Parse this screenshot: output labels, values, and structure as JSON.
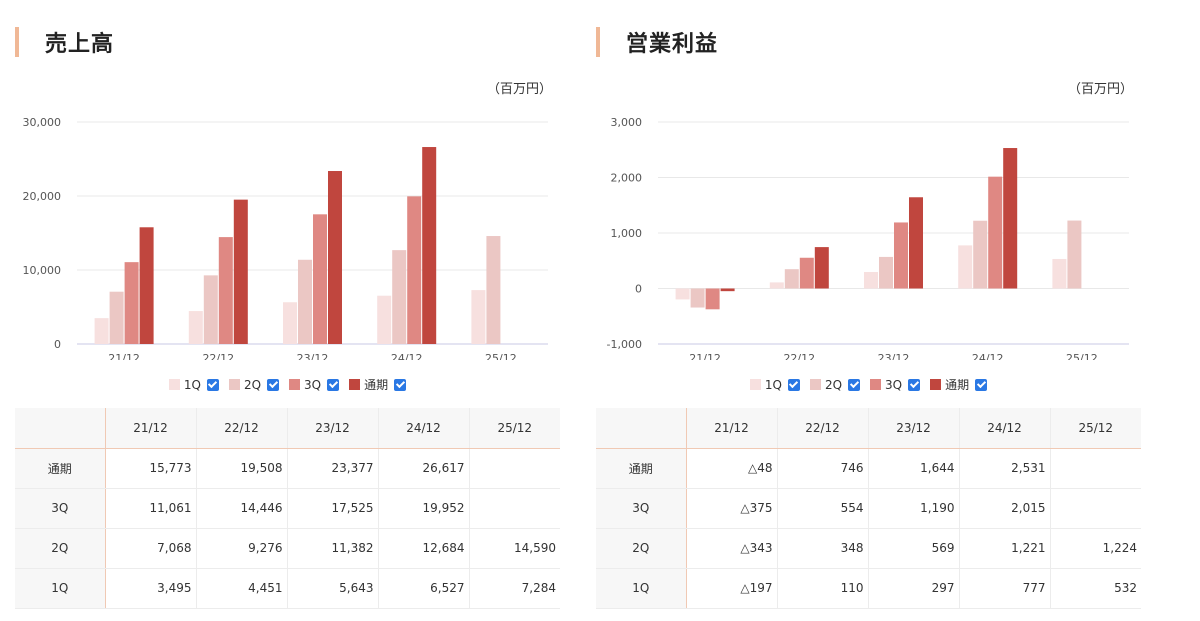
{
  "colors": {
    "q1": "#f7e0df",
    "q2": "#ebc7c4",
    "q3": "#df8883",
    "full": "#c0463e",
    "accent": "#f0b896",
    "checkbox": "#2a78e4"
  },
  "panels": [
    {
      "title": "売上高",
      "unit": "（百万円）",
      "legend": [
        "1Q",
        "2Q",
        "3Q",
        "通期"
      ],
      "table": {
        "headers": [
          "21/12",
          "22/12",
          "23/12",
          "24/12",
          "25/12"
        ],
        "rows": [
          {
            "label": "通期",
            "cells": [
              "15,773",
              "19,508",
              "23,377",
              "26,617",
              ""
            ]
          },
          {
            "label": "3Q",
            "cells": [
              "11,061",
              "14,446",
              "17,525",
              "19,952",
              ""
            ]
          },
          {
            "label": "2Q",
            "cells": [
              "7,068",
              "9,276",
              "11,382",
              "12,684",
              "14,590"
            ]
          },
          {
            "label": "1Q",
            "cells": [
              "3,495",
              "4,451",
              "5,643",
              "6,527",
              "7,284"
            ]
          }
        ]
      }
    },
    {
      "title": "営業利益",
      "unit": "（百万円）",
      "legend": [
        "1Q",
        "2Q",
        "3Q",
        "通期"
      ],
      "table": {
        "headers": [
          "21/12",
          "22/12",
          "23/12",
          "24/12",
          "25/12"
        ],
        "rows": [
          {
            "label": "通期",
            "cells": [
              "△48",
              "746",
              "1,644",
              "2,531",
              ""
            ]
          },
          {
            "label": "3Q",
            "cells": [
              "△375",
              "554",
              "1,190",
              "2,015",
              ""
            ]
          },
          {
            "label": "2Q",
            "cells": [
              "△343",
              "348",
              "569",
              "1,221",
              "1,224"
            ]
          },
          {
            "label": "1Q",
            "cells": [
              "△197",
              "110",
              "297",
              "777",
              "532"
            ]
          }
        ]
      }
    }
  ],
  "chart_data": [
    {
      "type": "bar",
      "categories": [
        "21/12",
        "22/12",
        "23/12",
        "24/12",
        "25/12"
      ],
      "series": [
        {
          "name": "1Q",
          "values": [
            3495,
            4451,
            5643,
            6527,
            7284
          ]
        },
        {
          "name": "2Q",
          "values": [
            7068,
            9276,
            11382,
            12684,
            14590
          ]
        },
        {
          "name": "3Q",
          "values": [
            11061,
            14446,
            17525,
            19952,
            null
          ]
        },
        {
          "name": "通期",
          "values": [
            15773,
            19508,
            23377,
            26617,
            null
          ]
        }
      ],
      "yticks": [
        "0",
        "10,000",
        "20,000",
        "30,000"
      ],
      "ylim": [
        0,
        30000
      ],
      "grid": true,
      "legend": "bottom"
    },
    {
      "type": "bar",
      "categories": [
        "21/12",
        "22/12",
        "23/12",
        "24/12",
        "25/12"
      ],
      "series": [
        {
          "name": "1Q",
          "values": [
            -197,
            110,
            297,
            777,
            532
          ]
        },
        {
          "name": "2Q",
          "values": [
            -343,
            348,
            569,
            1221,
            1224
          ]
        },
        {
          "name": "3Q",
          "values": [
            -375,
            554,
            1190,
            2015,
            null
          ]
        },
        {
          "name": "通期",
          "values": [
            -48,
            746,
            1644,
            2531,
            null
          ]
        }
      ],
      "yticks": [
        "-1,000",
        "0",
        "1,000",
        "2,000",
        "3,000"
      ],
      "ylim": [
        -1000,
        3000
      ],
      "grid": true,
      "legend": "bottom"
    }
  ]
}
